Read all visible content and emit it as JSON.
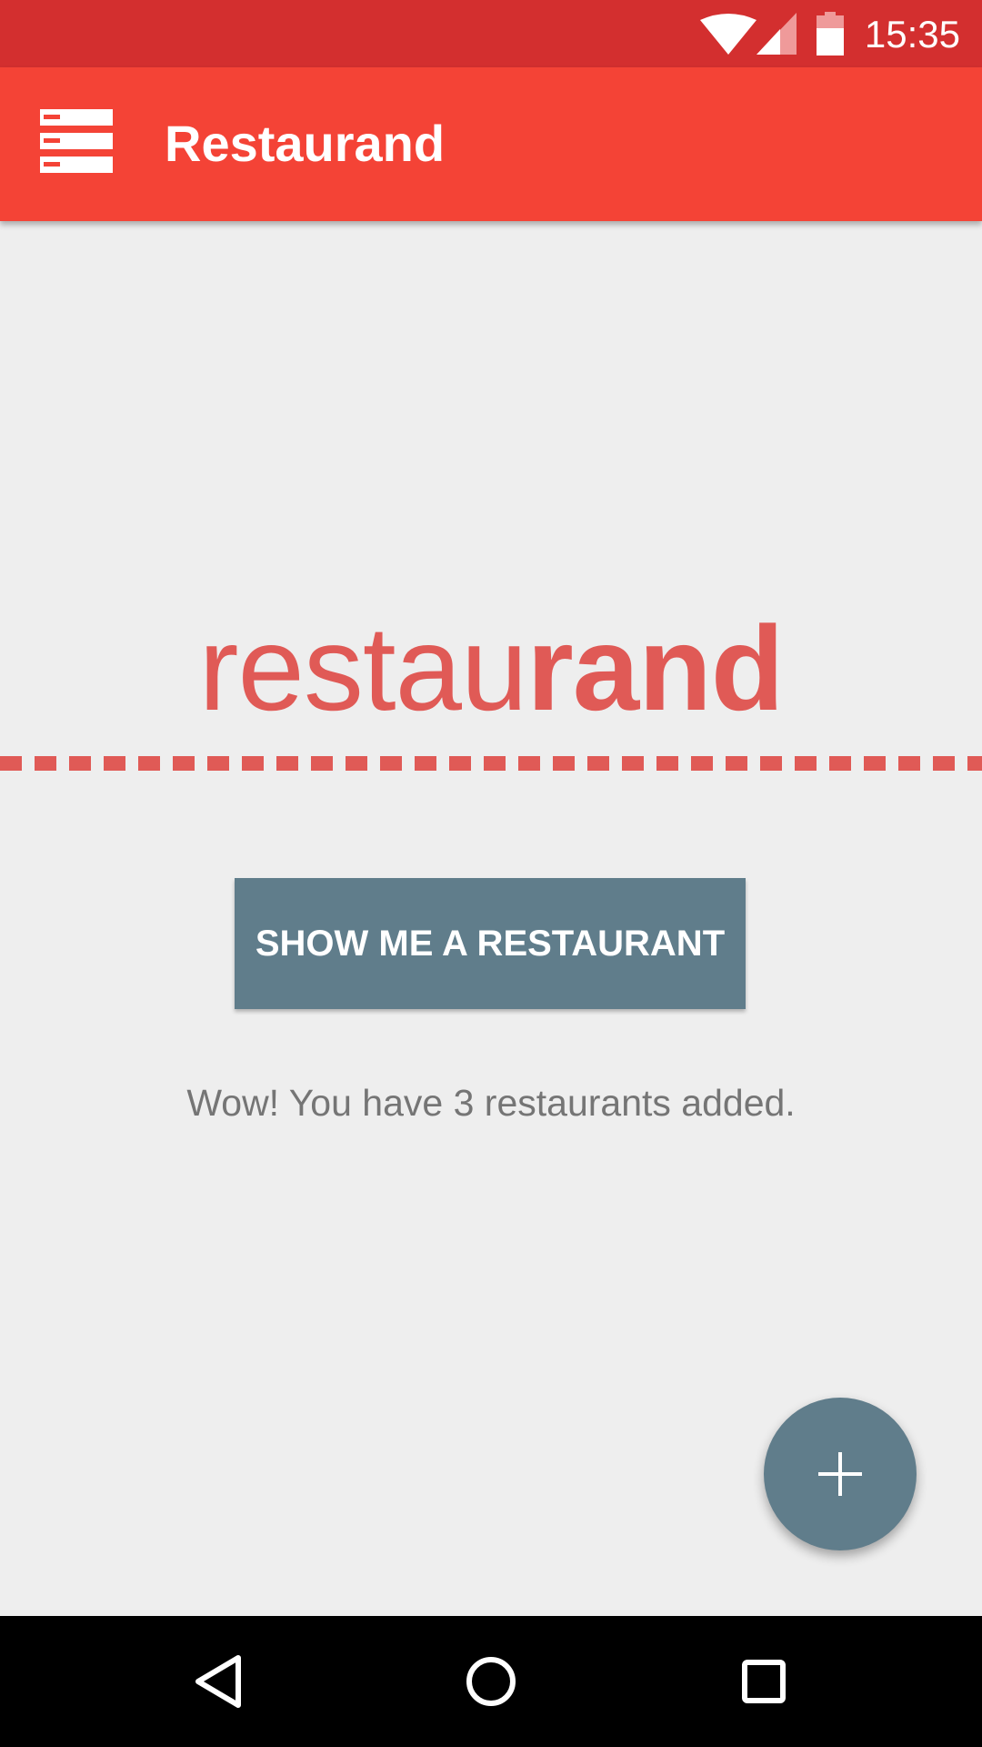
{
  "status_bar": {
    "time": "15:35",
    "icons": [
      "wifi-icon",
      "cell-signal-icon",
      "battery-icon"
    ]
  },
  "app_bar": {
    "title": "Restaurand",
    "menu_icon": "menu-icon"
  },
  "logo": {
    "part_light": "restau",
    "part_bold": "rand"
  },
  "main": {
    "button_label": "SHOW ME A RESTAURANT",
    "count_message": "Wow! You have 3 restaurants added."
  },
  "fab": {
    "icon": "plus-icon"
  },
  "nav_bar": {
    "icons": [
      "back-icon",
      "home-icon",
      "recents-icon"
    ]
  },
  "colors": {
    "status_bar": "#d32f2f",
    "app_bar": "#f44336",
    "accent": "#607d8b",
    "logo": "#e05a56",
    "background": "#eeeeee"
  }
}
